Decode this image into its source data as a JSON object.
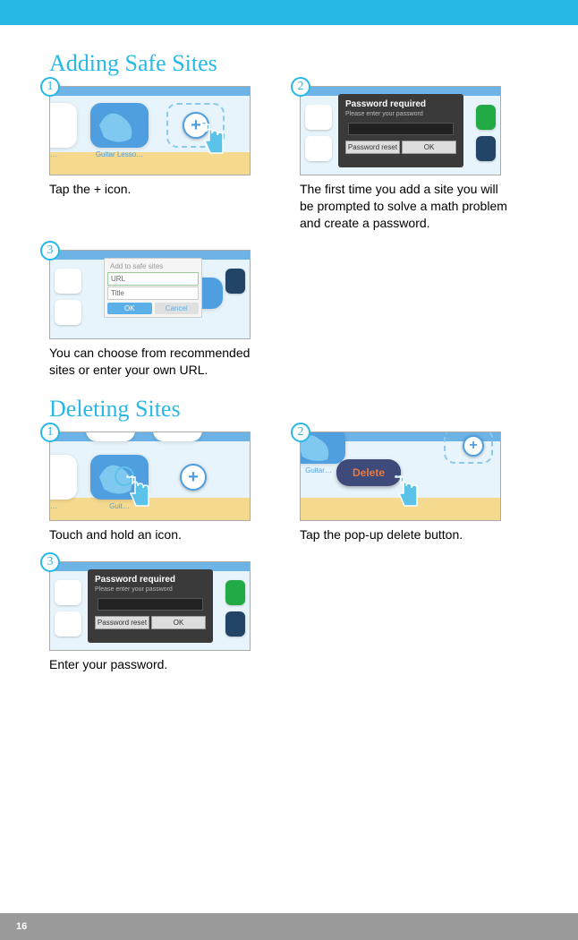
{
  "page_number": "16",
  "sections": {
    "adding": {
      "title": "Adding Safe Sites",
      "steps": [
        {
          "num": "1",
          "caption": "Tap the + icon.",
          "thumb": {
            "bubble_label_left": "sso…",
            "bubble_label_mid": "Guitar Lesso…"
          }
        },
        {
          "num": "2",
          "caption": "The first time you add a site you will be prompted to solve a math problem and create a password.",
          "thumb": {
            "modal_title": "Password required",
            "modal_sub": "Please enter your password",
            "btn_reset": "Password reset",
            "btn_ok": "OK"
          }
        },
        {
          "num": "3",
          "caption": "You can choose from recom­mended sites or enter your own URL.",
          "thumb": {
            "dialog_title": "Add to safe sites",
            "field_url": "URL",
            "field_title": "Title",
            "btn_ok": "OK",
            "btn_cancel": "Cancel"
          }
        }
      ]
    },
    "deleting": {
      "title": "Deleting Sites",
      "steps": [
        {
          "num": "1",
          "caption": "Touch and hold an icon.",
          "thumb": {
            "bubble_label_left": "sso…",
            "bubble_label_mid": "Guit…"
          }
        },
        {
          "num": "2",
          "caption": "Tap the pop-up delete button.",
          "thumb": {
            "bubble_label_left": "Guitar…",
            "delete_label": "Delete"
          }
        },
        {
          "num": "3",
          "caption": "Enter your password.",
          "thumb": {
            "modal_title": "Password required",
            "modal_sub": "Please enter your password",
            "btn_reset": "Password reset",
            "btn_ok": "OK"
          }
        }
      ]
    }
  }
}
